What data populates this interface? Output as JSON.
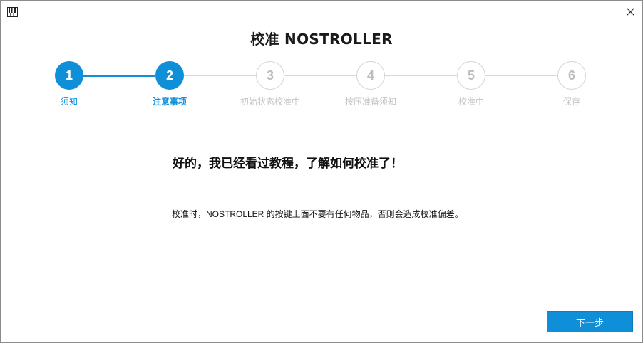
{
  "window": {
    "app_icon": "piano-keys-icon",
    "close_icon": "close-icon"
  },
  "title": "校准 NOSTROLLER",
  "steps": [
    {
      "number": "1",
      "label": "须知",
      "state": "done"
    },
    {
      "number": "2",
      "label": "注意事项",
      "state": "current"
    },
    {
      "number": "3",
      "label": "初始状态校准中",
      "state": "pending"
    },
    {
      "number": "4",
      "label": "按压准备须知",
      "state": "pending"
    },
    {
      "number": "5",
      "label": "校准中",
      "state": "pending"
    },
    {
      "number": "6",
      "label": "保存",
      "state": "pending"
    }
  ],
  "content": {
    "heading": "好的，我已经看过教程，了解如何校准了！",
    "note": "校准时，NOSTROLLER 的按键上面不要有任何物品，否则会造成校准偏差。"
  },
  "footer": {
    "next_label": "下一步"
  },
  "colors": {
    "accent": "#0f8fd8",
    "inactive": "#c4c4c4"
  }
}
